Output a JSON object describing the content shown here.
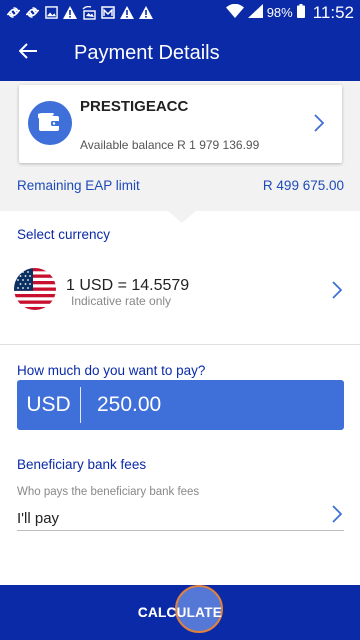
{
  "status_bar": {
    "battery": "98%",
    "time": "11:52"
  },
  "app_bar": {
    "title": "Payment Details"
  },
  "account": {
    "name": "PRESTIGEACC",
    "balance": "Available balance R 1 979 136.99"
  },
  "eap": {
    "label": "Remaining EAP limit",
    "value": "R 499 675.00"
  },
  "currency": {
    "section_label": "Select currency",
    "rate": "1 USD = 14.5579",
    "rate_note": "Indicative rate only"
  },
  "amount": {
    "section_label": "How much do you want to pay?",
    "currency_code": "USD",
    "value": "250.00"
  },
  "fees": {
    "section_label": "Beneficiary bank fees",
    "hint": "Who pays the beneficiary bank fees",
    "value": "I'll pay"
  },
  "calculate": {
    "label": "CALCULATE"
  },
  "colors": {
    "primary": "#0a2aa8",
    "accent": "#3f6fd8",
    "link": "#1e4bb8"
  }
}
